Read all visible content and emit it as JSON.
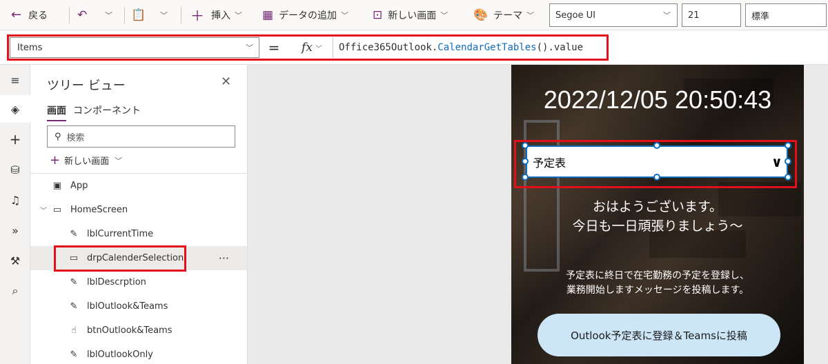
{
  "toolbar": {
    "back_label": "戻る",
    "insert_label": "挿入",
    "add_data_label": "データの追加",
    "new_screen_label": "新しい画面",
    "theme_label": "テーマ",
    "font_value": "Segoe UI",
    "font_size_value": "21",
    "font_weight_value": "標準"
  },
  "formula_bar": {
    "property": "Items",
    "equals": "=",
    "fx": "fx",
    "formula_prefix": "Office365Outlook.",
    "formula_fn": "CalendarGetTables",
    "formula_suffix": "().value"
  },
  "tree": {
    "title": "ツリー ビュー",
    "tabs": [
      "画面",
      "コンポーネント"
    ],
    "search_placeholder": "検索",
    "new_screen": "新しい画面",
    "nodes": {
      "app": "App",
      "home_screen": "HomeScreen",
      "lbl_current_time": "lblCurrentTime",
      "drp_calender_selection": "drpCalenderSelection",
      "lbl_descrption": "lblDescrption",
      "lbl_outlook_teams": "lblOutlook&Teams",
      "btn_outlook_teams": "btnOutlook&Teams",
      "lbl_outlook_only": "lblOutlookOnly"
    },
    "more": "···"
  },
  "app_screen": {
    "clock": "2022/12/05 20:50:43",
    "dropdown_value": "予定表",
    "greeting_line1": "おはようございます。",
    "greeting_line2": "今日も一日頑張りましょう～",
    "desc_line1": "予定表に終日で在宅勤務の予定を登録し、",
    "desc_line2": "業務開始しますメッセージを投稿します。",
    "post_button": "Outlook予定表に登録＆Teamsに投稿"
  },
  "colors": {
    "accent": "#742774",
    "highlight_red": "#e3101c",
    "selection_blue": "#0f6cbd",
    "post_button_bg": "#cde6f7"
  }
}
